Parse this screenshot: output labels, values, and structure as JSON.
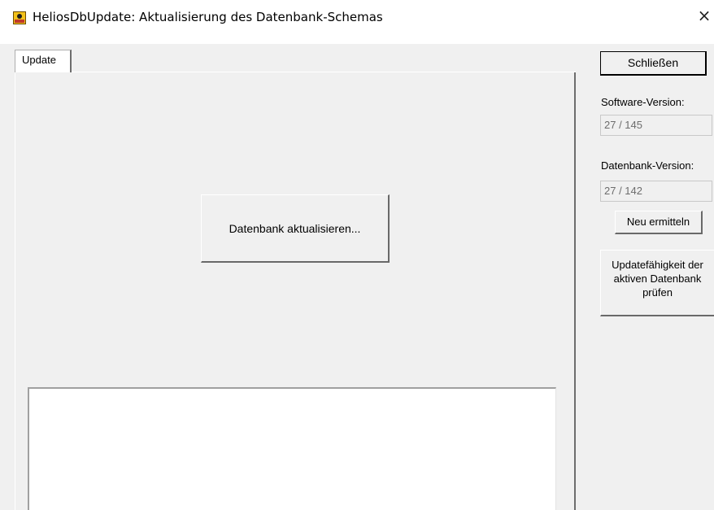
{
  "window": {
    "title": "HeliosDbUpdate: Aktualisierung des Datenbank-Schemas",
    "icon": "helios-app-icon",
    "close_glyph": "×"
  },
  "tabs": [
    {
      "label": "Update",
      "selected": true
    }
  ],
  "main": {
    "update_button_label": "Datenbank aktualisieren...",
    "log_text": ""
  },
  "side": {
    "close_button_label": "Schließen",
    "software_version_label": "Software-Version:",
    "software_version_value": "27 / 145",
    "db_version_label": "Datenbank-Version:",
    "db_version_value": "27 / 142",
    "refresh_button_label": "Neu ermitteln",
    "check_button_label": "Updatefähigkeit der aktiven Datenbank prüfen"
  }
}
